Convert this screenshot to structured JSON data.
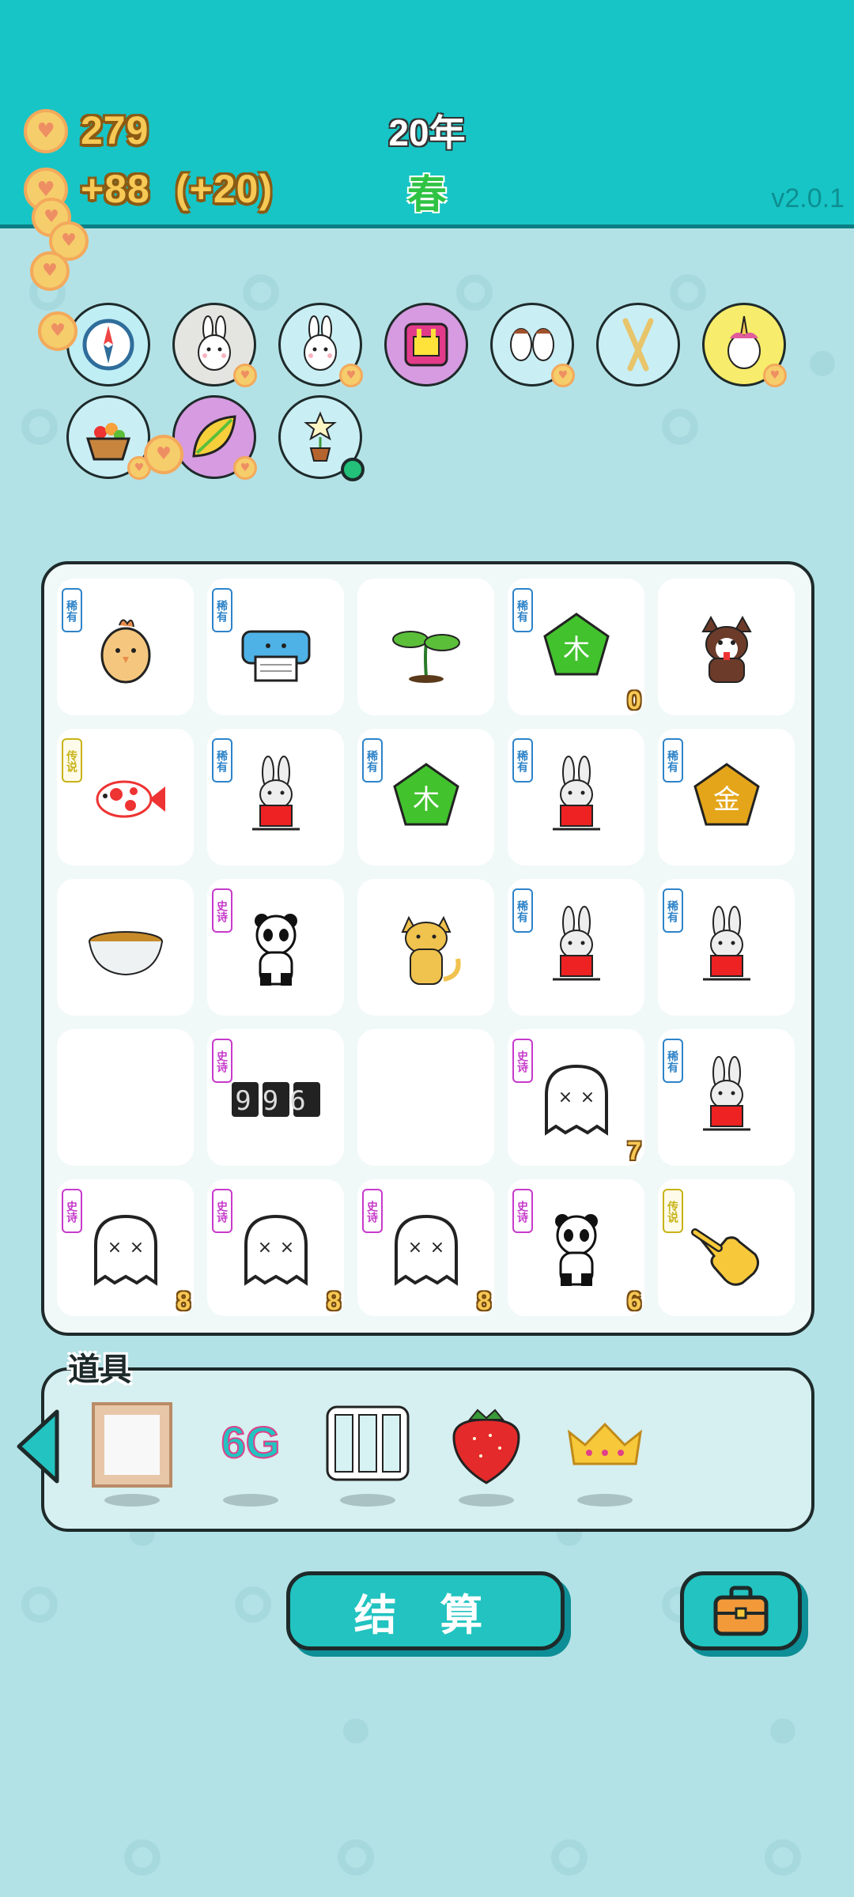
{
  "header": {
    "coins": "279",
    "income": "+88",
    "bonus": "(+20)",
    "year": "20年",
    "season": "春",
    "version": "v2.0.1",
    "accent_color": "#17c5c6"
  },
  "owned_items": [
    {
      "icon": "compass-icon"
    },
    {
      "icon": "rabbit-icon"
    },
    {
      "icon": "rabbit-icon"
    },
    {
      "icon": "pink-box-icon"
    },
    {
      "icon": "two-horses-icon"
    },
    {
      "icon": "chopsticks-icon"
    },
    {
      "icon": "unicorn-icon"
    },
    {
      "icon": "fruit-basket-icon"
    },
    {
      "icon": "leaf-icon"
    },
    {
      "icon": "flower-pot-icon"
    }
  ],
  "board": {
    "cells": [
      {
        "badge": "稀有",
        "icon": "chick-icon",
        "count": ""
      },
      {
        "badge": "稀有",
        "icon": "printer-icon",
        "count": ""
      },
      {
        "badge": "",
        "icon": "sprout-icon",
        "count": ""
      },
      {
        "badge": "稀有",
        "icon": "wood-element-icon",
        "label": "木",
        "count": "0"
      },
      {
        "badge": "",
        "icon": "husky-icon",
        "count": ""
      },
      {
        "badge": "传说",
        "icon": "koi-fish-icon",
        "count": ""
      },
      {
        "badge": "稀有",
        "icon": "rabbit-icon",
        "count": ""
      },
      {
        "badge": "稀有",
        "icon": "wood-element-icon",
        "label": "木",
        "count": ""
      },
      {
        "badge": "稀有",
        "icon": "rabbit-icon",
        "count": ""
      },
      {
        "badge": "稀有",
        "icon": "gold-element-icon",
        "label": "金",
        "count": ""
      },
      {
        "badge": "",
        "icon": "tea-bowl-icon",
        "count": ""
      },
      {
        "badge": "史诗",
        "icon": "panda-icon",
        "count": ""
      },
      {
        "badge": "",
        "icon": "orange-cat-icon",
        "count": ""
      },
      {
        "badge": "稀有",
        "icon": "rabbit-icon",
        "count": ""
      },
      {
        "badge": "稀有",
        "icon": "rabbit-icon",
        "count": ""
      },
      {
        "badge": "",
        "icon": "",
        "count": ""
      },
      {
        "badge": "史诗",
        "icon": "996-counter-icon",
        "label": "996",
        "count": ""
      },
      {
        "badge": "",
        "icon": "",
        "count": ""
      },
      {
        "badge": "史诗",
        "icon": "ghost-icon",
        "count": "7"
      },
      {
        "badge": "稀有",
        "icon": "rabbit-icon",
        "count": ""
      },
      {
        "badge": "史诗",
        "icon": "ghost-icon",
        "count": "8"
      },
      {
        "badge": "史诗",
        "icon": "ghost-icon",
        "count": "8"
      },
      {
        "badge": "史诗",
        "icon": "ghost-icon",
        "count": "8"
      },
      {
        "badge": "史诗",
        "icon": "panda-icon",
        "count": "6"
      },
      {
        "badge": "传说",
        "icon": "pointing-hand-icon",
        "count": ""
      }
    ]
  },
  "items_panel": {
    "title": "道具",
    "items": [
      {
        "icon": "picture-frame-icon"
      },
      {
        "icon": "6g-icon",
        "label": "6G"
      },
      {
        "icon": "triple-panel-icon"
      },
      {
        "icon": "strawberry-icon"
      },
      {
        "icon": "crown-icon"
      }
    ]
  },
  "buttons": {
    "settle_label": "结 算",
    "bag_icon": "briefcase-icon",
    "back_icon": "left-arrow-icon"
  }
}
